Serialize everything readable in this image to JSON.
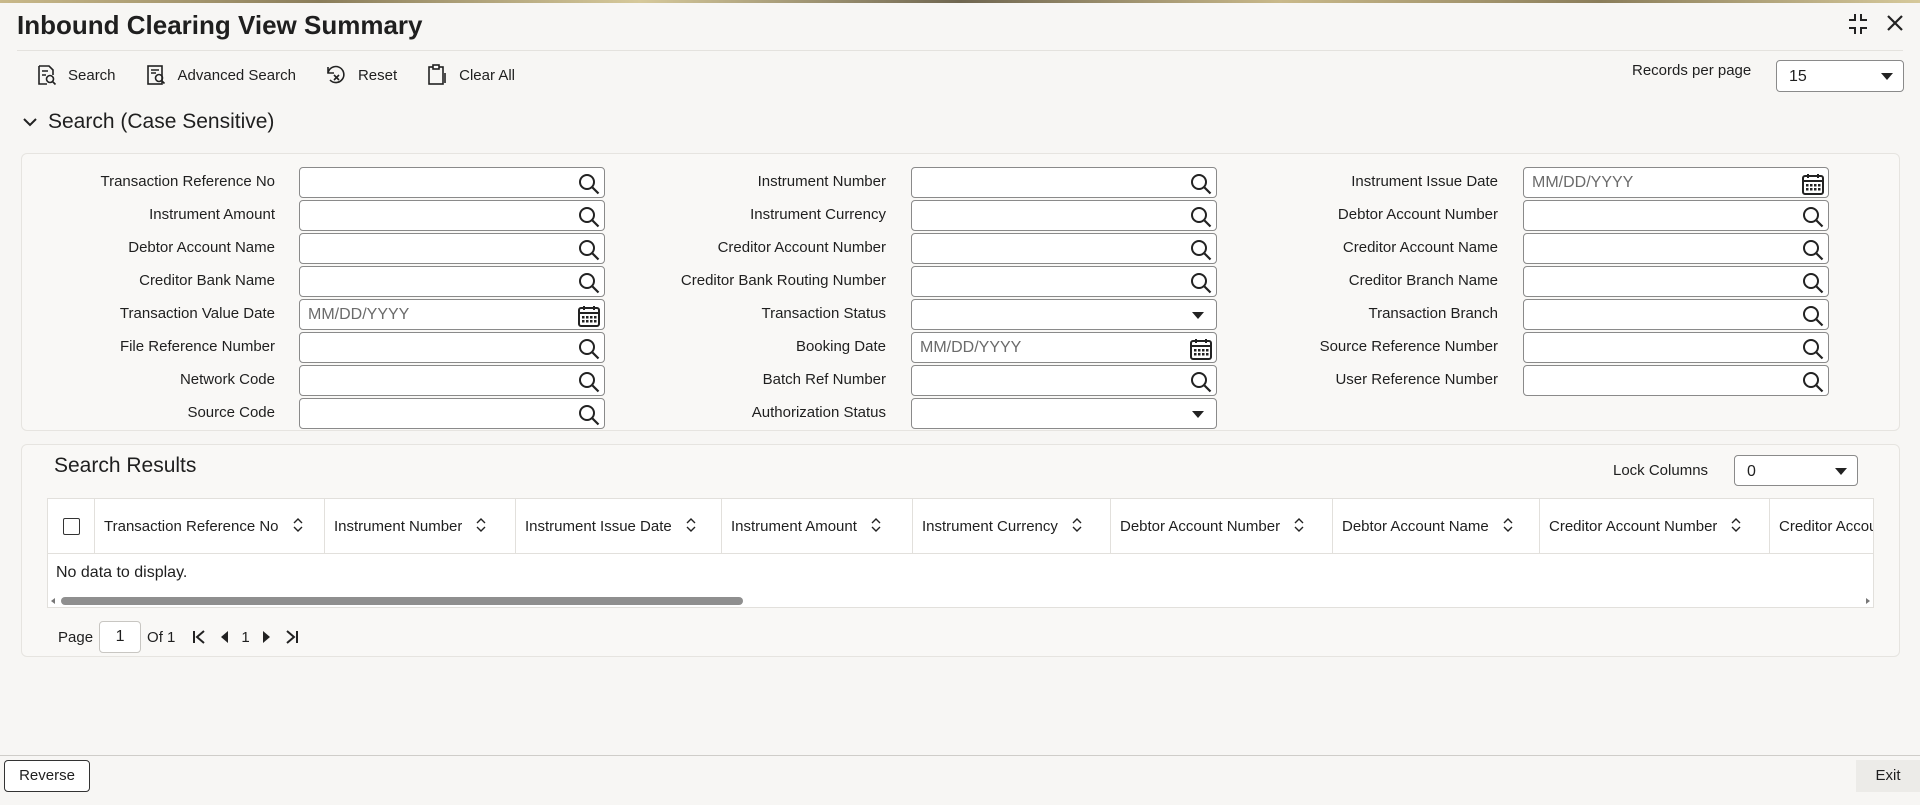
{
  "window": {
    "title": "Inbound Clearing View Summary"
  },
  "toolbar": {
    "search": "Search",
    "advanced_search": "Advanced Search",
    "reset": "Reset",
    "clear_all": "Clear All",
    "records_per_page_label": "Records per page",
    "records_per_page_value": "15"
  },
  "search_section": {
    "title": "Search (Case Sensitive)",
    "fields": [
      {
        "label": "Transaction Reference No",
        "type": "lookup",
        "value": "",
        "placeholder": ""
      },
      {
        "label": "Instrument Number",
        "type": "lookup",
        "value": "",
        "placeholder": ""
      },
      {
        "label": "Instrument Issue Date",
        "type": "date",
        "value": "",
        "placeholder": "MM/DD/YYYY"
      },
      {
        "label": "Instrument Amount",
        "type": "lookup",
        "value": "",
        "placeholder": ""
      },
      {
        "label": "Instrument Currency",
        "type": "lookup",
        "value": "",
        "placeholder": ""
      },
      {
        "label": "Debtor Account Number",
        "type": "lookup",
        "value": "",
        "placeholder": ""
      },
      {
        "label": "Debtor Account Name",
        "type": "lookup",
        "value": "",
        "placeholder": ""
      },
      {
        "label": "Creditor Account Number",
        "type": "lookup",
        "value": "",
        "placeholder": ""
      },
      {
        "label": "Creditor Account Name",
        "type": "lookup",
        "value": "",
        "placeholder": ""
      },
      {
        "label": "Creditor Bank Name",
        "type": "lookup",
        "value": "",
        "placeholder": ""
      },
      {
        "label": "Creditor Bank Routing Number",
        "type": "lookup",
        "value": "",
        "placeholder": ""
      },
      {
        "label": "Creditor Branch Name",
        "type": "lookup",
        "value": "",
        "placeholder": ""
      },
      {
        "label": "Transaction Value Date",
        "type": "date",
        "value": "",
        "placeholder": "MM/DD/YYYY"
      },
      {
        "label": "Transaction Status",
        "type": "select",
        "value": "",
        "placeholder": ""
      },
      {
        "label": "Transaction Branch",
        "type": "lookup",
        "value": "",
        "placeholder": ""
      },
      {
        "label": "File Reference Number",
        "type": "lookup",
        "value": "",
        "placeholder": ""
      },
      {
        "label": "Booking Date",
        "type": "date",
        "value": "",
        "placeholder": "MM/DD/YYYY"
      },
      {
        "label": "Source Reference Number",
        "type": "lookup",
        "value": "",
        "placeholder": ""
      },
      {
        "label": "Network Code",
        "type": "lookup",
        "value": "",
        "placeholder": ""
      },
      {
        "label": "Batch Ref Number",
        "type": "lookup",
        "value": "",
        "placeholder": ""
      },
      {
        "label": "User Reference Number",
        "type": "lookup",
        "value": "",
        "placeholder": ""
      },
      {
        "label": "Source Code",
        "type": "lookup",
        "value": "",
        "placeholder": ""
      },
      {
        "label": "Authorization Status",
        "type": "select",
        "value": "",
        "placeholder": ""
      }
    ]
  },
  "results": {
    "title": "Search Results",
    "lock_columns_label": "Lock Columns",
    "lock_columns_value": "0",
    "columns": [
      "Transaction Reference No",
      "Instrument Number",
      "Instrument Issue Date",
      "Instrument Amount",
      "Instrument Currency",
      "Debtor Account Number",
      "Debtor Account Name",
      "Creditor Account Number",
      "Creditor Account Name"
    ],
    "empty_text": "No data to display."
  },
  "pagination": {
    "page_label": "Page",
    "page_value": "1",
    "of_label": "Of 1",
    "current": "1"
  },
  "footer": {
    "reverse": "Reverse",
    "exit": "Exit"
  },
  "colors": {
    "background": "#f7f6f4",
    "panel": "#f9f8f6",
    "border": "#8a8a8a",
    "text": "#1f1f1f"
  }
}
